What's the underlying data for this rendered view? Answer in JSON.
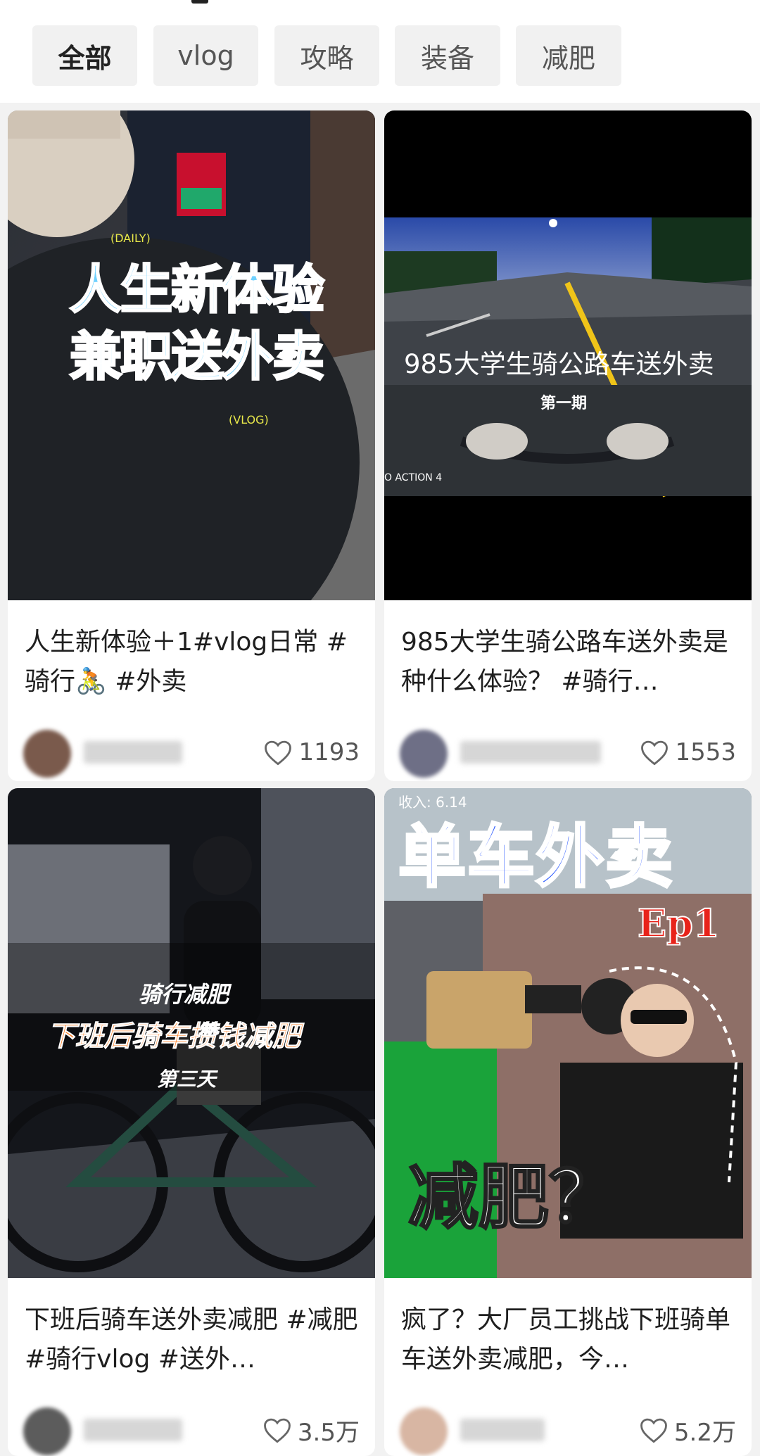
{
  "tabs": [
    "全部",
    "vlog",
    "攻略",
    "装备",
    "减肥"
  ],
  "active_tab": "全部",
  "cards": [
    {
      "title": "人生新体验＋1#vlog日常 #骑行🚴 #外卖",
      "likes": "1193",
      "overlay": {
        "tag1": "(DAILY)",
        "line1": "人生新体验",
        "line2": "兼职送外卖",
        "tag2": "(VLOG)"
      },
      "colors": {
        "overlay_text": "#6fd1ff",
        "overlay_outline": "#ffffff"
      }
    },
    {
      "title": "985大学生骑公路车送外卖是种什么体验？ #骑行…",
      "likes": "1553",
      "overlay": {
        "headline": "985大学生骑公路车送外卖",
        "sub": "第一期",
        "watermark": "O ACTION 4"
      }
    },
    {
      "title": "下班后骑车送外卖减肥 #减肥 #骑行vlog #送外…",
      "likes": "3.5万",
      "overlay": {
        "line1": "骑行减肥",
        "line2": "下班后骑车攒钱减肥",
        "line3": "第三天"
      },
      "colors": {
        "line2": "#ff7a1a"
      }
    },
    {
      "title": "疯了？大厂员工挑战下班骑单车送外卖减肥，今…",
      "likes": "5.2万",
      "overlay": {
        "headline": "单车外卖",
        "episode": "Ep1",
        "bottom": "减肥？",
        "top_snip": "收入: 6.14"
      },
      "colors": {
        "headline": "#1e4fff",
        "episode": "#e8231a"
      }
    }
  ]
}
